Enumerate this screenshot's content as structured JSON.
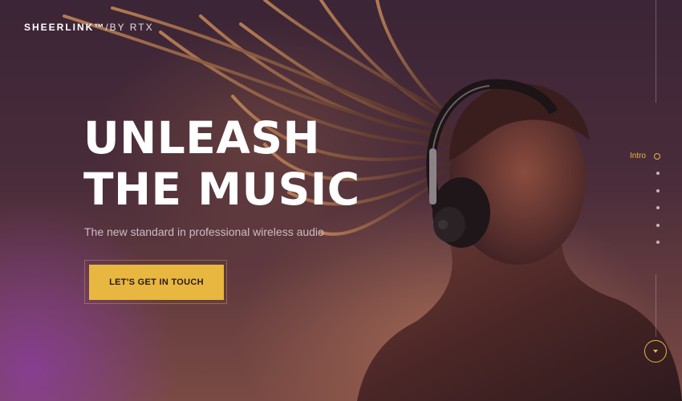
{
  "brand": {
    "name": "SHEERLINK™",
    "suffix": "/BY RTX"
  },
  "hero": {
    "headline_line1": "UNLEASH",
    "headline_line2": "THE MUSIC",
    "subtitle": "The new standard in professional wireless audio",
    "cta_label": "LET'S GET IN TOUCH"
  },
  "section_nav": {
    "active_label": "Intro",
    "items": [
      "intro",
      "section-2",
      "section-3",
      "section-4",
      "section-5",
      "section-6"
    ]
  },
  "colors": {
    "accent": "#e8b740",
    "background": "#3a2434",
    "text": "#ffffff",
    "subtitle": "#cbbcc4"
  },
  "icons": {
    "scroll_down": "chevron-down-icon",
    "hero_image": "woman-with-headphones-photo"
  }
}
